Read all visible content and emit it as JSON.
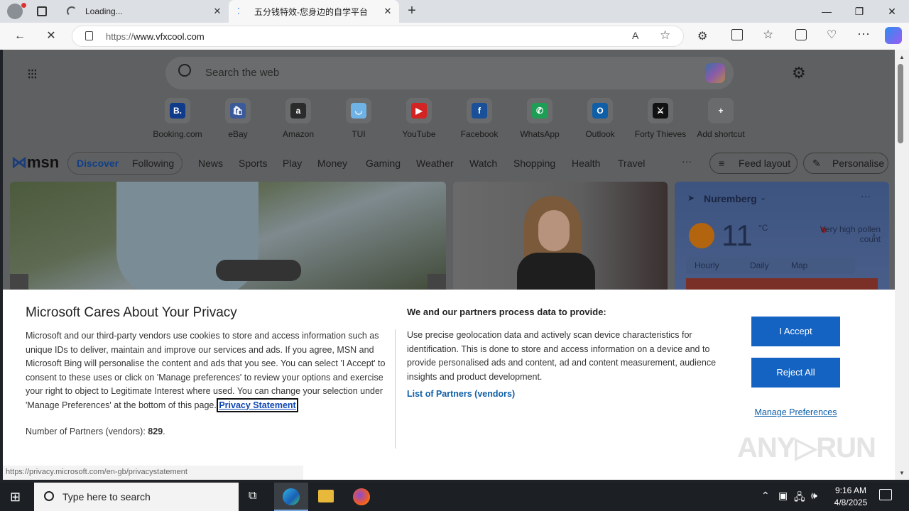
{
  "browser": {
    "tabs": [
      {
        "title": "Loading..."
      },
      {
        "title": "五分钱特效-您身边的自学平台"
      }
    ],
    "url_prefix": "https://",
    "url_host": "www.vfxcool.com",
    "status_url": "https://privacy.microsoft.com/en-gb/privacystatement"
  },
  "newtab": {
    "search_placeholder": "Search the web",
    "shortcuts": [
      {
        "label": "Booking.com",
        "glyph": "B.",
        "color": "#0f3b8a"
      },
      {
        "label": "eBay",
        "glyph": "🛍",
        "color": "#3b5a9a"
      },
      {
        "label": "Amazon",
        "glyph": "a",
        "color": "#2b2b2b"
      },
      {
        "label": "TUI",
        "glyph": "◡",
        "color": "#6fb2e5"
      },
      {
        "label": "YouTube",
        "glyph": "▶",
        "color": "#d32323"
      },
      {
        "label": "Facebook",
        "glyph": "f",
        "color": "#1a4f9a"
      },
      {
        "label": "WhatsApp",
        "glyph": "✆",
        "color": "#1e9e55"
      },
      {
        "label": "Outlook",
        "glyph": "O",
        "color": "#0f5fa8"
      },
      {
        "label": "Forty Thieves",
        "glyph": "⚔",
        "color": "#111111"
      },
      {
        "label": "Add shortcut",
        "glyph": "+",
        "color": "#6a6b6c"
      }
    ],
    "msn_logo": "msn",
    "feed_tabs": [
      "Discover",
      "Following"
    ],
    "nav_items": [
      "News",
      "Sports",
      "Play",
      "Money",
      "Gaming",
      "Weather",
      "Watch",
      "Shopping",
      "Health",
      "Travel"
    ],
    "more": "···",
    "feed_layout": "Feed layout",
    "personalise": "Personalise",
    "weather": {
      "city": "Nuremberg",
      "temp": "11",
      "unit": "°C",
      "alert": "Very high pollen count",
      "tabs": [
        "Hourly",
        "Daily",
        "Map"
      ]
    }
  },
  "privacy": {
    "title": "Microsoft Cares About Your Privacy",
    "body": "Microsoft and our third-party vendors use cookies to store and access information such as unique IDs to deliver, maintain and improve our services and ads. If you agree, MSN and Microsoft Bing will personalise the content and ads that you see. You can select 'I Accept' to consent to these uses or click on 'Manage preferences' to review your options and exercise your right to object to Legitimate Interest where used.  You can change your selection under 'Manage Preferences' at the bottom of this page.",
    "link": "Privacy Statement",
    "partners_label": "Number of Partners (vendors):",
    "partners_count": "829",
    "data_title": "We and our partners process data to provide:",
    "data_body": "Use precise geolocation data and actively scan device characteristics for identification. This is done to store and access information on a device and to provide personalised ads and content, ad and content measurement, audience insights and product development.",
    "list_link": "List of Partners (vendors)",
    "accept": "I Accept",
    "reject": "Reject All",
    "manage": "Manage Preferences"
  },
  "taskbar": {
    "search_placeholder": "Type here to search",
    "time": "9:16 AM",
    "date": "4/8/2025"
  }
}
